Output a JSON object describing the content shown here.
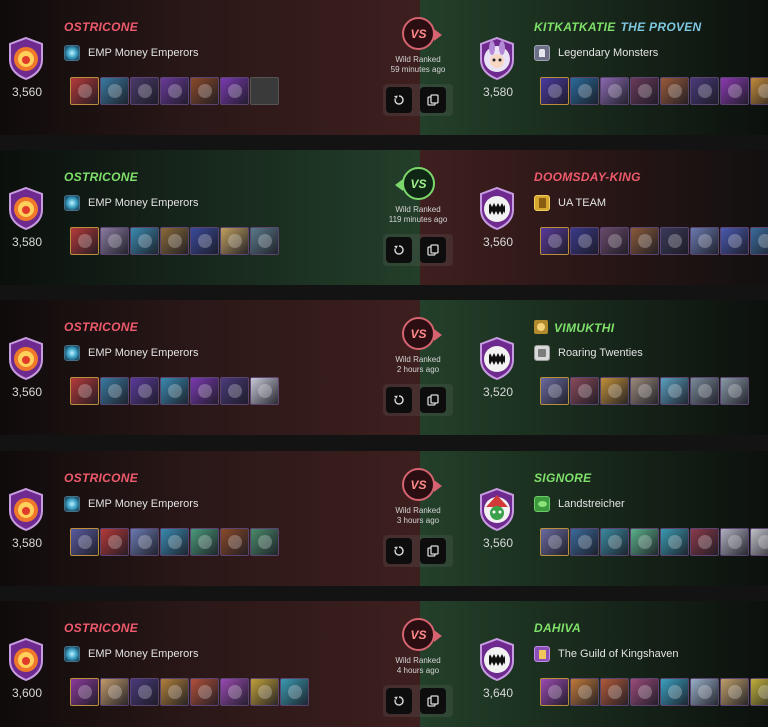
{
  "colors": {
    "winner_name": "#7fe06a",
    "loser_name": "#ef5a6c",
    "title": "#7ec7e0"
  },
  "battles": [
    {
      "winner": "right",
      "left": {
        "name": "OSTRICONE",
        "guild": "EMP Money Emperors",
        "guild_icon": "emp-guild-icon",
        "rating": "3,560",
        "avatar": "fire-avatar-icon",
        "cards": [
          "#b43a3a",
          "#3a7aa0",
          "#4a3a6a",
          "#6a3a9a",
          "#8a4a2a",
          "#7a3ab0",
          "#3a3a3a"
        ]
      },
      "right": {
        "name": "KITKATKATIE",
        "title": "THE PROVEN",
        "guild": "Legendary Monsters",
        "guild_icon": "legendary-guild-icon",
        "rating": "3,580",
        "avatar": "bunny-avatar-icon",
        "cards": [
          "#4a3aa0",
          "#2a6a9a",
          "#8a6ab0",
          "#6a3a5a",
          "#9a5a3a",
          "#4a3a7a",
          "#8a3ab0",
          "#c08a3a"
        ]
      },
      "mode": "Wild Ranked",
      "time": "59 minutes ago"
    },
    {
      "winner": "left",
      "left": {
        "name": "OSTRICONE",
        "guild": "EMP Money Emperors",
        "guild_icon": "emp-guild-icon",
        "rating": "3,580",
        "avatar": "fire-avatar-icon",
        "cards": [
          "#b43a3a",
          "#8a7aa0",
          "#3a8ab0",
          "#8a6a3a",
          "#3a4a9a",
          "#c0a060",
          "#5a7a8a"
        ]
      },
      "right": {
        "name": "DOOMSDAY-KING",
        "guild": "UA TEAM",
        "guild_icon": "ua-guild-icon",
        "rating": "3,560",
        "avatar": "fanged-mouth-avatar-icon",
        "cards": [
          "#5a3a9a",
          "#3a3a8a",
          "#6a4a6a",
          "#8a5a3a",
          "#3a3a5a",
          "#6a7ab0",
          "#4a5ab0",
          "#3a6a9a"
        ]
      },
      "mode": "Wild Ranked",
      "time": "119 minutes ago"
    },
    {
      "winner": "right",
      "left": {
        "name": "OSTRICONE",
        "guild": "EMP Money Emperors",
        "guild_icon": "emp-guild-icon",
        "rating": "3,560",
        "avatar": "fire-avatar-icon",
        "cards": [
          "#b43a3a",
          "#3a7aa0",
          "#5a3a9a",
          "#3a8ab0",
          "#7a3ab0",
          "#4a3a7a",
          "#c8c8d8"
        ]
      },
      "right": {
        "name": "VIMUKTHI",
        "guild": "Roaring Twenties",
        "guild_icon": "roaring-guild-icon",
        "rating": "3,520",
        "avatar": "fanged-mouth-avatar-icon",
        "cards": [
          "#6a6aa0",
          "#8a4a5a",
          "#c0903a",
          "#9a8a7a",
          "#5aa0c0",
          "#7a8a9a",
          "#8a9aa8"
        ]
      },
      "mode": "Wild Ranked",
      "time": "2 hours ago"
    },
    {
      "winner": "right",
      "left": {
        "name": "OSTRICONE",
        "guild": "EMP Money Emperors",
        "guild_icon": "emp-guild-icon",
        "rating": "3,580",
        "avatar": "fire-avatar-icon",
        "cards": [
          "#5a5aa0",
          "#b43a3a",
          "#6a7ab0",
          "#3a8ab0",
          "#4a9a7a",
          "#8a4a2a",
          "#4a8a6a"
        ]
      },
      "right": {
        "name": "SIGNORE",
        "guild": "Landstreicher",
        "guild_icon": "landstreicher-guild-icon",
        "rating": "3,560",
        "avatar": "jester-avatar-icon",
        "cards": [
          "#6a6aa0",
          "#3a6a9a",
          "#3a8aa0",
          "#5ab08a",
          "#3a9ab0",
          "#8a3a4a",
          "#b0b0c0",
          "#c0c0c8"
        ]
      },
      "mode": "Wild Ranked",
      "time": "3 hours ago"
    },
    {
      "winner": "right",
      "left": {
        "name": "OSTRICONE",
        "guild": "EMP Money Emperors",
        "guild_icon": "emp-guild-icon",
        "rating": "3,600",
        "avatar": "fire-avatar-icon",
        "cards": [
          "#8a3a9a",
          "#c09a6a",
          "#4a3a7a",
          "#b0803a",
          "#b0503a",
          "#9a4ab0",
          "#c0a03a",
          "#3a9ab0"
        ]
      },
      "right": {
        "name": "DAHIVA",
        "guild": "The Guild of Kingshaven",
        "guild_icon": "kingshaven-guild-icon",
        "rating": "3,640",
        "avatar": "fanged-mouth-avatar-icon",
        "cards": [
          "#9a4ab0",
          "#c07a3a",
          "#b05a3a",
          "#9a4a7a",
          "#3aa0c0",
          "#9ab0c8",
          "#c0a06a",
          "#c0b03a"
        ]
      },
      "mode": "Wild Ranked",
      "time": "4 hours ago"
    }
  ]
}
